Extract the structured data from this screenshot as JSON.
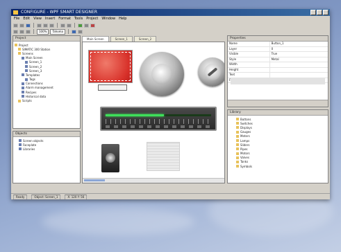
{
  "window": {
    "title": "CONFIGURE - WPF SMART DESIGNER",
    "menus": [
      "File",
      "Edit",
      "View",
      "Insert",
      "Format",
      "Tools",
      "Project",
      "Window",
      "Help"
    ]
  },
  "toolbar": {
    "zoom_value": "100%",
    "font_value": "Tahoma"
  },
  "project_tree": {
    "title": "Project",
    "items": [
      {
        "label": "Project",
        "level": 0
      },
      {
        "label": "SIMATIC 300 Station",
        "level": 1
      },
      {
        "label": "Screens",
        "level": 1
      },
      {
        "label": "Main Screen",
        "level": 2
      },
      {
        "label": "Screen_1",
        "level": 3
      },
      {
        "label": "Screen_2",
        "level": 3
      },
      {
        "label": "Screen_3",
        "level": 3
      },
      {
        "label": "Templates",
        "level": 2
      },
      {
        "label": "Tags",
        "level": 3
      },
      {
        "label": "Connections",
        "level": 2
      },
      {
        "label": "Alarm management",
        "level": 2
      },
      {
        "label": "Recipes",
        "level": 2
      },
      {
        "label": "Historical data",
        "level": 2
      },
      {
        "label": "Scripts",
        "level": 1
      }
    ]
  },
  "objects_pane": {
    "title": "Objects",
    "items": [
      "Screen objects",
      "Faceplate",
      "Libraries"
    ]
  },
  "canvas": {
    "tabs": [
      "Main Screen",
      "Screen_1",
      "Screen_2"
    ],
    "meter_level": 0.55
  },
  "properties": {
    "title": "Properties",
    "rows": [
      {
        "k": "Name",
        "v": "Button_1"
      },
      {
        "k": "Layer",
        "v": "0"
      },
      {
        "k": "Visible",
        "v": "True"
      },
      {
        "k": "Style",
        "v": "Metal"
      },
      {
        "k": "Width",
        "v": ""
      },
      {
        "k": "Height",
        "v": ""
      },
      {
        "k": "Text",
        "v": ""
      },
      {
        "k": "Font",
        "v": ""
      }
    ]
  },
  "library": {
    "title": "Library",
    "items": [
      "Buttons",
      "Switches",
      "Displays",
      "Gauges",
      "Meters",
      "Lamps",
      "Sliders",
      "Pipes",
      "Motors",
      "Valves",
      "Tanks",
      "Symbols"
    ]
  },
  "status": {
    "cells": [
      "Ready",
      "Object: Screen_1",
      "X: 120 Y: 56"
    ]
  },
  "colors": {
    "accent": "#0a246a",
    "meter_led": "#3ee05a",
    "alarm_panel": "#d8312a"
  }
}
